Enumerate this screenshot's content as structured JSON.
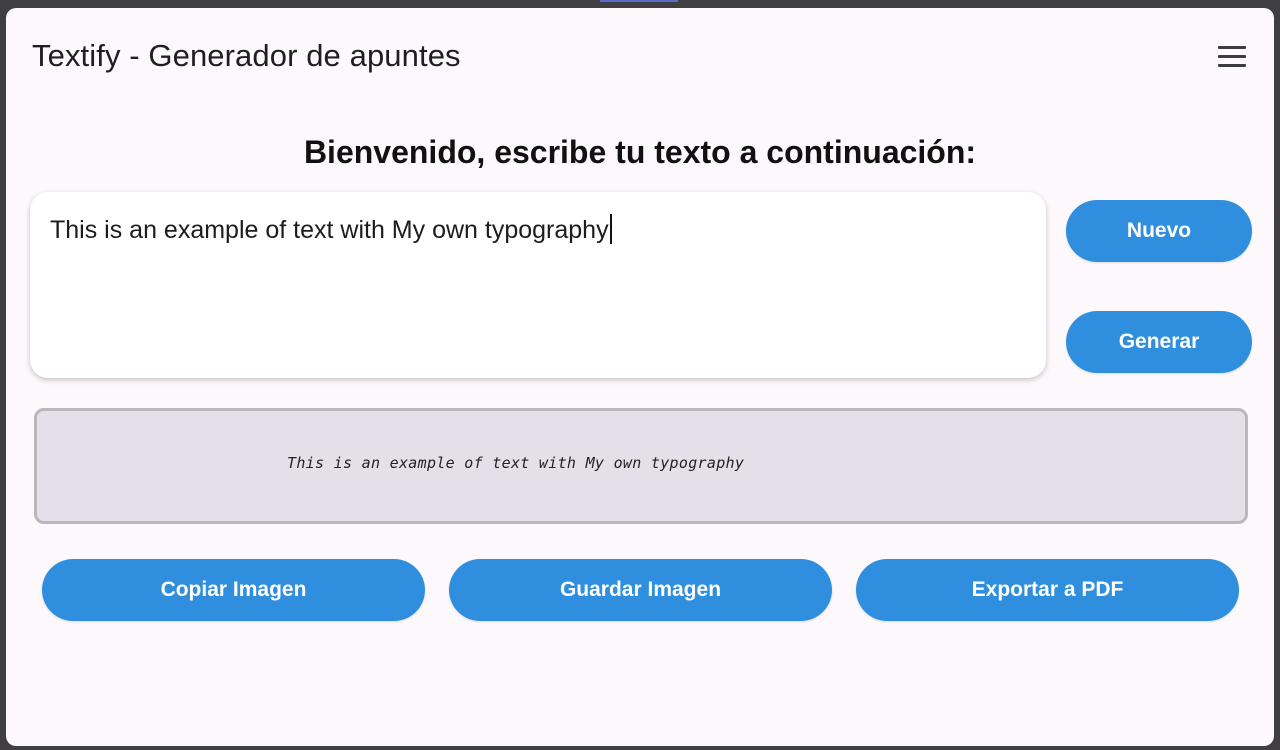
{
  "app": {
    "title": "Textify - Generador de apuntes",
    "menu_icon": "hamburger-menu-icon"
  },
  "main": {
    "headline": "Bienvenido, escribe tu texto a continuación:",
    "text_input": {
      "value": "This is an example of text with My own typography"
    },
    "side_buttons": {
      "new_label": "Nuevo",
      "generate_label": "Generar"
    },
    "preview": {
      "rendered_text": "This is an example of text with My own typography"
    },
    "actions": {
      "copy_label": "Copiar Imagen",
      "save_label": "Guardar Imagen",
      "export_label": "Exportar a PDF"
    }
  },
  "colors": {
    "accent": "#2f8fde",
    "background": "#fcf8fc",
    "preview_background": "#e4dfe9"
  }
}
